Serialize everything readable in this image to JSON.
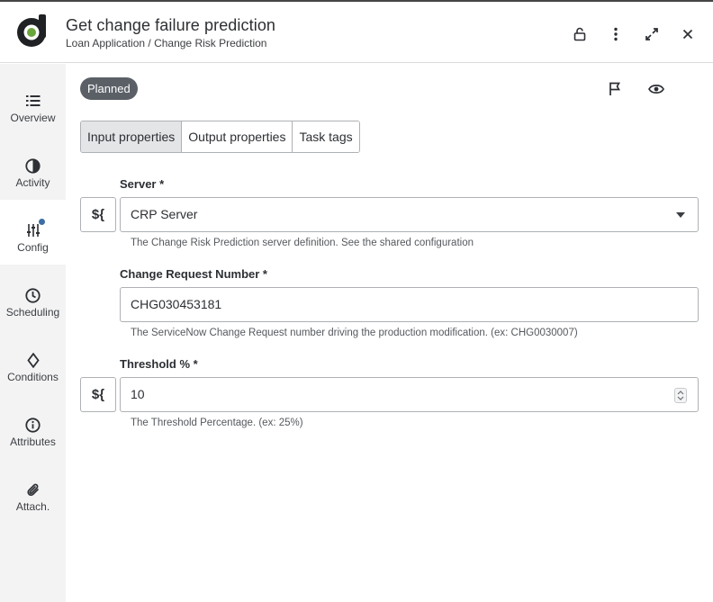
{
  "header": {
    "title": "Get change failure prediction",
    "breadcrumb": "Loan Application / Change Risk Prediction",
    "icons": [
      "lock-open-icon",
      "more-vertical-icon",
      "expand-icon",
      "close-icon"
    ]
  },
  "status_badge": "Planned",
  "sidebar": {
    "items": [
      {
        "label": "Overview",
        "icon": "list-icon"
      },
      {
        "label": "Activity",
        "icon": "pie-icon"
      },
      {
        "label": "Config",
        "icon": "sliders-icon",
        "active": true,
        "dot": true
      },
      {
        "label": "Scheduling",
        "icon": "clock-icon"
      },
      {
        "label": "Conditions",
        "icon": "diamond-icon"
      },
      {
        "label": "Attributes",
        "icon": "info-icon"
      },
      {
        "label": "Attach.",
        "icon": "paperclip-icon"
      }
    ]
  },
  "tabs": [
    {
      "label": "Input properties",
      "active": true
    },
    {
      "label": "Output properties"
    },
    {
      "label": "Task tags"
    }
  ],
  "variable_button_label": "${",
  "fields": {
    "server": {
      "label": "Server *",
      "value": "CRP Server",
      "help": "The Change Risk Prediction server definition. See the shared configuration"
    },
    "change_request": {
      "label": "Change Request Number *",
      "value": "CHG030453181",
      "help": "The ServiceNow Change Request number driving the production modification. (ex: CHG0030007)"
    },
    "threshold": {
      "label": "Threshold % *",
      "value": "10",
      "help": "The Threshold Percentage. (ex: 25%)"
    }
  },
  "colors": {
    "badge_bg": "#5b6067",
    "sidebar_bg": "#f3f3f4",
    "notification_dot": "#3e6ea5",
    "logo_green": "#6aa53b"
  }
}
